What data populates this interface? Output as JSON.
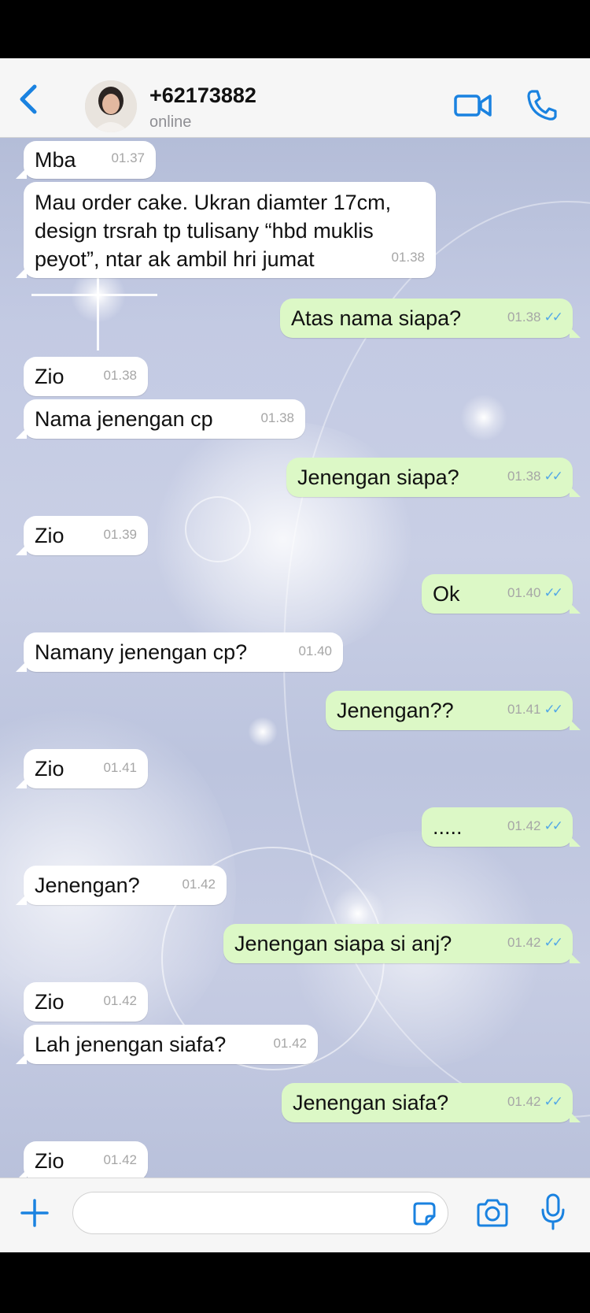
{
  "header": {
    "contact_name": "+62173882",
    "status": "online"
  },
  "colors": {
    "accent": "#1a82e0",
    "incoming_bubble": "#ffffff",
    "outgoing_bubble": "#dcf8c6",
    "read_ticks": "#53a8e6"
  },
  "messages": [
    {
      "dir": "in",
      "text": "Mba",
      "time": "01.37"
    },
    {
      "dir": "in",
      "text": "Mau order cake. Ukran diamter 17cm,\ndesign trsrah tp tulisany “hbd muklis\npeyot”, ntar ak ambil hri jumat",
      "time": "01.38"
    },
    {
      "dir": "out",
      "text": "Atas nama siapa?",
      "time": "01.38"
    },
    {
      "dir": "in",
      "text": "Zio",
      "time": "01.38"
    },
    {
      "dir": "in",
      "text": "Nama jenengan cp",
      "time": "01.38"
    },
    {
      "dir": "out",
      "text": "Jenengan siapa?",
      "time": "01.38"
    },
    {
      "dir": "in",
      "text": "Zio",
      "time": "01.39"
    },
    {
      "dir": "out",
      "text": "Ok",
      "time": "01.40"
    },
    {
      "dir": "in",
      "text": "Namany jenengan cp?",
      "time": "01.40"
    },
    {
      "dir": "out",
      "text": "Jenengan??",
      "time": "01.41"
    },
    {
      "dir": "in",
      "text": "Zio",
      "time": "01.41"
    },
    {
      "dir": "out",
      "text": ".....",
      "time": "01.42"
    },
    {
      "dir": "in",
      "text": "Jenengan?",
      "time": "01.42"
    },
    {
      "dir": "out",
      "text": "Jenengan siapa si anj?",
      "time": "01.42"
    },
    {
      "dir": "in",
      "text": "Zio",
      "time": "01.42"
    },
    {
      "dir": "in",
      "text": "Lah jenengan siafa?",
      "time": "01.42"
    },
    {
      "dir": "out",
      "text": "Jenengan siafa?",
      "time": "01.42"
    },
    {
      "dir": "in",
      "text": "Zio",
      "time": "01.42"
    }
  ],
  "composer": {
    "placeholder": ""
  },
  "icons": {
    "back": "chevron-left-icon",
    "video": "video-camera-icon",
    "call": "phone-icon",
    "plus": "plus-icon",
    "sticker": "sticker-icon",
    "camera": "camera-icon",
    "mic": "microphone-icon"
  }
}
